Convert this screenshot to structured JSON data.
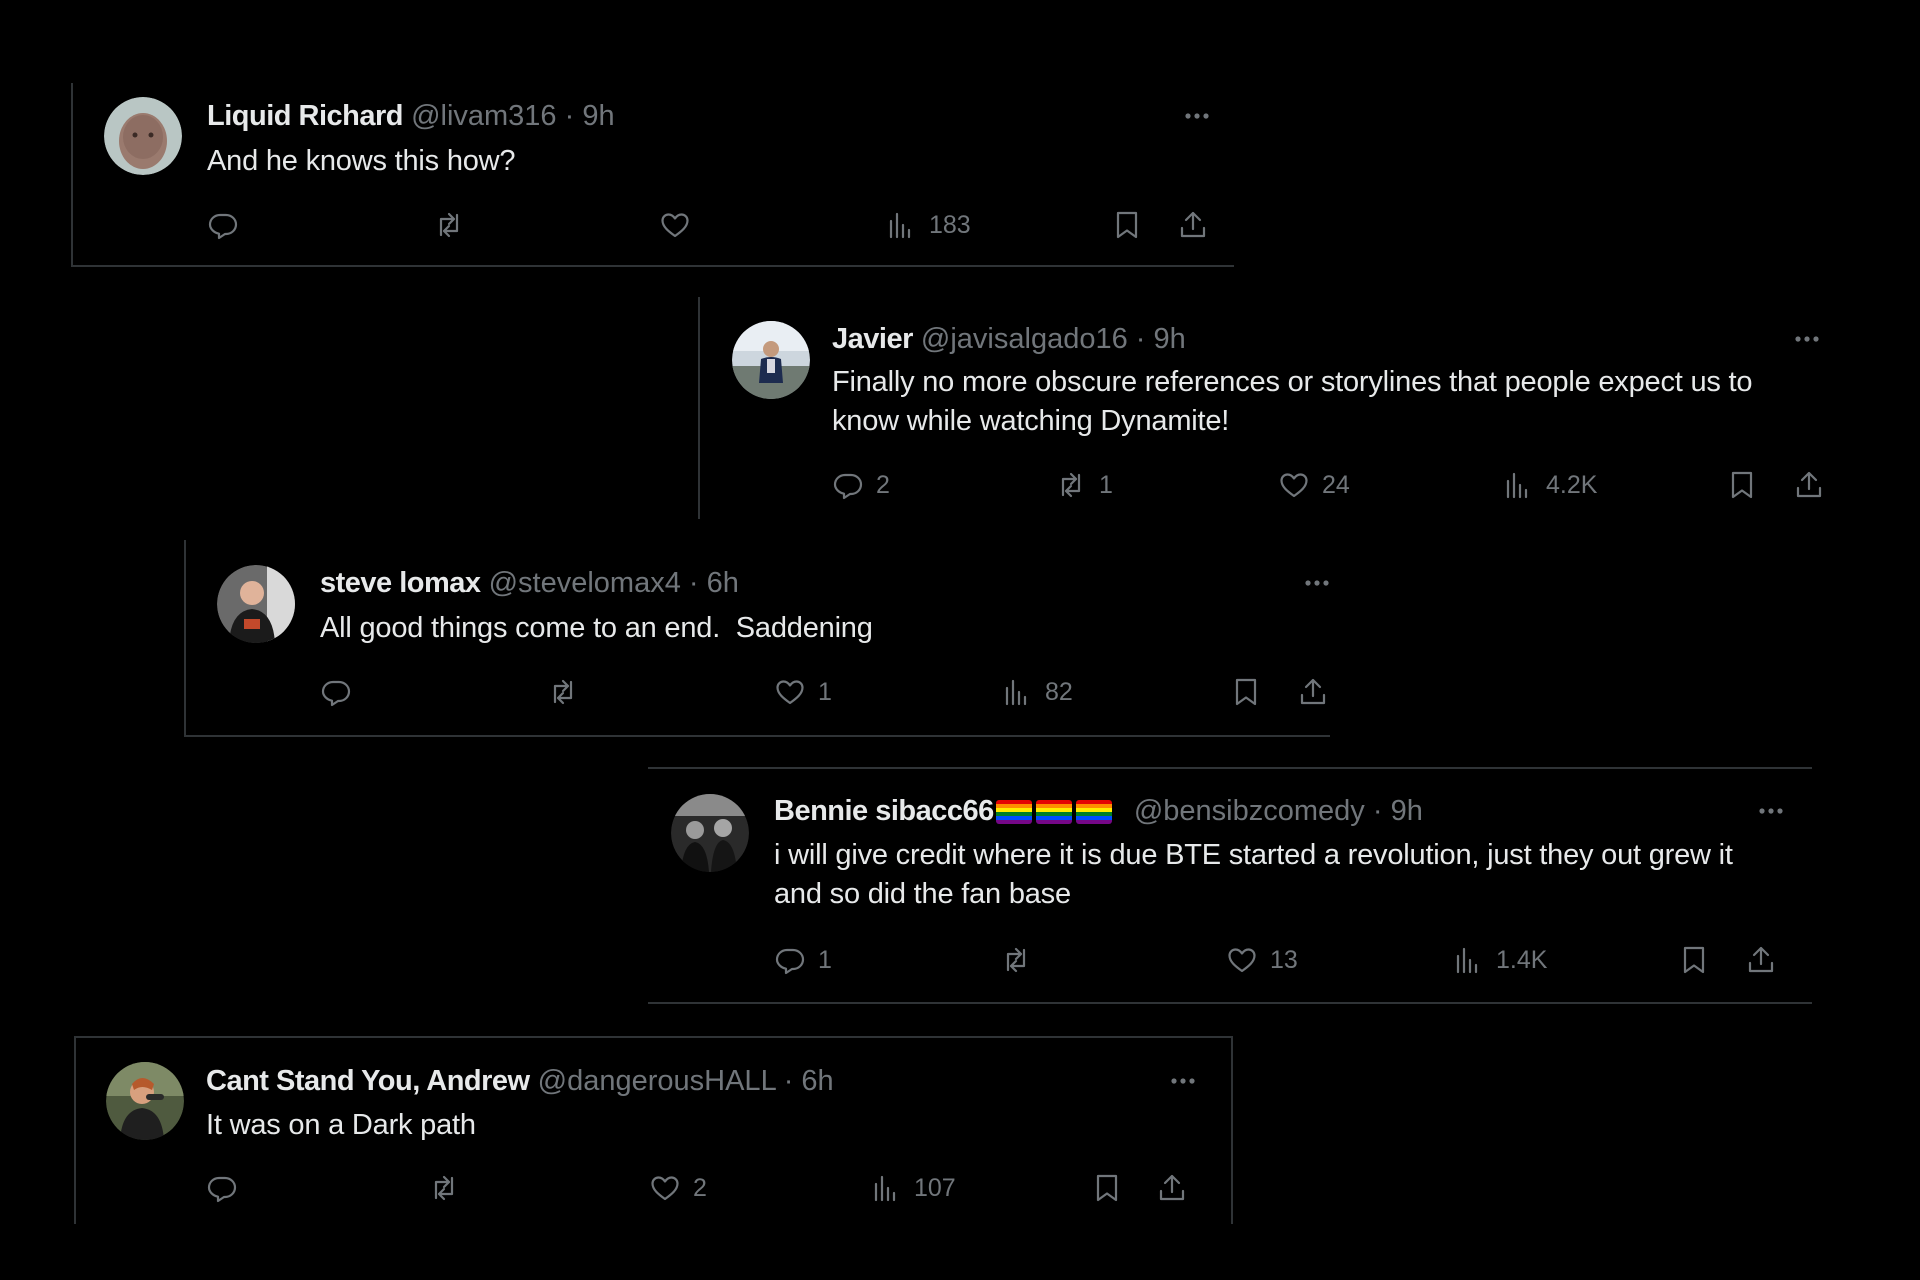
{
  "colors": {
    "background": "#000000",
    "text_primary": "#e7e9ea",
    "text_secondary": "#71767b",
    "border": "#2f3336"
  },
  "tweets": [
    {
      "name": "Liquid Richard",
      "handle": "@livam316",
      "separator": "·",
      "time": "9h",
      "text": "And he knows this how?",
      "replies": "",
      "reposts": "",
      "likes": "",
      "views": "183"
    },
    {
      "name": "Javier",
      "handle": "@javisalgado16",
      "separator": "·",
      "time": "9h",
      "text": "Finally no more obscure references or storylines that people expect us to know while watching Dynamite!",
      "replies": "2",
      "reposts": "1",
      "likes": "24",
      "views": "4.2K"
    },
    {
      "name": "steve lomax",
      "handle": "@stevelomax4",
      "separator": "·",
      "time": "6h",
      "text": "All good things come to an end.  Saddening",
      "replies": "",
      "reposts": "",
      "likes": "1",
      "views": "82"
    },
    {
      "name": "Bennie sibacc66",
      "name_icons": [
        "rainbow-flag",
        "rainbow-flag",
        "rainbow-flag"
      ],
      "handle": "@bensibzcomedy",
      "separator": "·",
      "time": "9h",
      "text": "i will give credit where it is due BTE started a revolution, just they out grew it and so did the fan base",
      "replies": "1",
      "reposts": "",
      "likes": "13",
      "views": "1.4K"
    },
    {
      "name": "Cant Stand You, Andrew",
      "handle": "@dangerousHALL",
      "separator": "·",
      "time": "6h",
      "text": "It was on a Dark path",
      "replies": "",
      "reposts": "",
      "likes": "2",
      "views": "107"
    }
  ],
  "icons": {
    "more": "more-dots-icon",
    "reply": "reply-icon",
    "repost": "repost-icon",
    "like": "heart-icon",
    "views": "views-chart-icon",
    "bookmark": "bookmark-icon",
    "share": "share-icon"
  }
}
